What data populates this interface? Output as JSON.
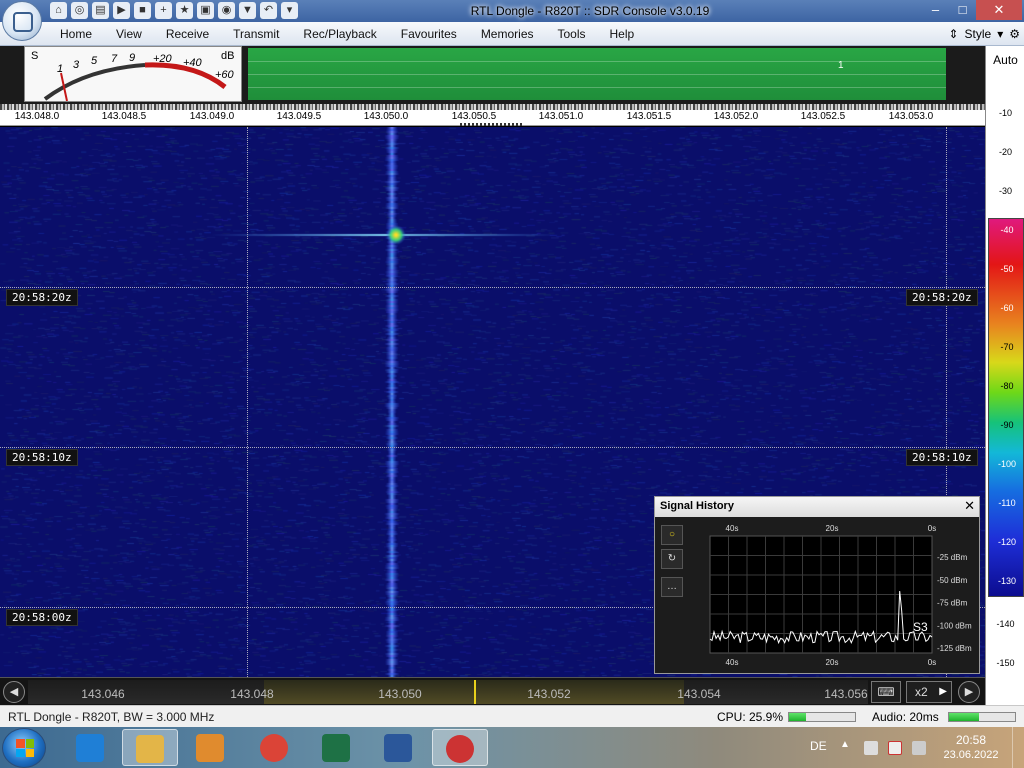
{
  "window": {
    "title": "RTL Dongle - R820T :: SDR Console v3.0.19",
    "minimize": "–",
    "maximize": "□",
    "close": "✕"
  },
  "quick_access": [
    {
      "icon": "home-icon",
      "glyph": "⌂"
    },
    {
      "icon": "help-lifebuoy-icon",
      "glyph": "◎"
    },
    {
      "icon": "folder-icon",
      "glyph": "▤"
    },
    {
      "icon": "play-icon",
      "glyph": "▶"
    },
    {
      "icon": "stop-icon",
      "glyph": "■"
    },
    {
      "icon": "add-icon",
      "glyph": "+"
    },
    {
      "icon": "star-icon",
      "glyph": "★"
    },
    {
      "icon": "lock-icon",
      "glyph": "▣"
    },
    {
      "icon": "camera-icon",
      "glyph": "◉"
    },
    {
      "icon": "drop-icon",
      "glyph": "▼"
    },
    {
      "icon": "undo-icon",
      "glyph": "↶"
    },
    {
      "icon": "customize-icon",
      "glyph": "▾"
    }
  ],
  "menu": {
    "items": [
      "Home",
      "View",
      "Receive",
      "Transmit",
      "Rec/Playback",
      "Favourites",
      "Memories",
      "Tools",
      "Help"
    ],
    "style_label": "Style"
  },
  "smeter": {
    "s_label": "S",
    "db_label": "dB",
    "scale": [
      "1",
      "3",
      "5",
      "7",
      "9",
      "+20",
      "+40",
      "+60"
    ]
  },
  "spectrum": {
    "vfo_number": "1"
  },
  "ruler": {
    "labels": [
      "143.048.0",
      "143.048.5",
      "143.049.0",
      "143.049.5",
      "143.050.0",
      "143.050.5",
      "143.051.0",
      "143.051.5",
      "143.052.0",
      "143.052.5",
      "143.053.0"
    ]
  },
  "waterfall": {
    "timestamps": [
      "20:58:20z",
      "20:58:10z",
      "20:58:00z"
    ]
  },
  "signal_history": {
    "title": "Signal History",
    "close": "✕",
    "top_time_labels": [
      "40s",
      "20s",
      "0s"
    ],
    "bottom_time_labels": [
      "40s",
      "20s",
      "0s"
    ],
    "dbm_labels": [
      "-25 dBm",
      "-50 dBm",
      "-75 dBm",
      "-100 dBm",
      "-125 dBm"
    ],
    "s_value": "S3",
    "buttons": [
      "○",
      "↻",
      "…"
    ]
  },
  "right_scale": {
    "auto_label": "Auto",
    "db_top": [
      "-10",
      "-20",
      "-30"
    ],
    "db_color": [
      "-40",
      "-50",
      "-60",
      "-70",
      "-80",
      "-90",
      "-100",
      "-110",
      "-120",
      "-130"
    ],
    "db_bottom": [
      "-140",
      "-150"
    ]
  },
  "bottom_nav": {
    "labels": [
      "143.046",
      "143.048",
      "143.050",
      "143.052",
      "143.054",
      "143.056"
    ],
    "zoom": "x2",
    "left_arrow": "◀",
    "right_arrow": "▶",
    "keyboard": "⌨"
  },
  "status": {
    "left": "RTL Dongle - R820T, BW = 3.000 MHz",
    "cpu": "CPU: 25.9%",
    "cpu_fraction": 0.259,
    "audio": "Audio: 20ms",
    "audio_fraction": 0.45
  },
  "taskbar": {
    "apps": [
      {
        "name": "internet-explorer",
        "color": "#1f7fd6"
      },
      {
        "name": "file-explorer",
        "color": "#e3b548"
      },
      {
        "name": "media-player",
        "color": "#e08b2e"
      },
      {
        "name": "chrome",
        "color": "#db4437"
      },
      {
        "name": "excel",
        "color": "#1e7145"
      },
      {
        "name": "word",
        "color": "#2b579a"
      },
      {
        "name": "sdr-console",
        "color": "#c33"
      }
    ],
    "language": "DE",
    "time": "20:58",
    "date": "23.06.2022"
  },
  "colors": {
    "waterfall_bg": "#0a0e6a",
    "signal": "#3b6bff",
    "spectrum_green": "#29a645",
    "tuner_marker": "#e8d01c"
  }
}
